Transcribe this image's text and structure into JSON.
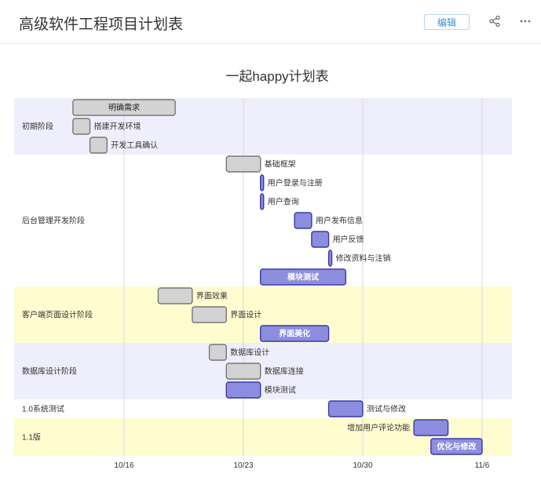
{
  "header": {
    "title": "高级软件工程项目计划表",
    "edit_label": "编辑",
    "share_icon": "share-icon",
    "more_icon": "more-icon"
  },
  "colors": {
    "band_a": "#efeefc",
    "band_b": "#fffdd0",
    "band_c": "#ffffff",
    "bar_done": "#d3d3d3",
    "bar_done_stroke": "#777777",
    "bar_active": "#8d8de0",
    "bar_active_stroke": "#3838a8",
    "grid": "#d8d8d8"
  },
  "chart_data": {
    "type": "gantt",
    "title": "一起happy计划表",
    "x_ticks": [
      "10/16",
      "10/23",
      "10/30",
      "11/6"
    ],
    "x_range": [
      "2023-10-10",
      "2023-11-08"
    ],
    "sections": [
      {
        "name": "初期阶段",
        "band": "a",
        "rows": 3
      },
      {
        "name": "后台管理开发阶段",
        "band": "c",
        "rows": 7
      },
      {
        "name": "客户端页面设计阶段",
        "band": "b",
        "rows": 3
      },
      {
        "name": "数据库设计阶段",
        "band": "a",
        "rows": 3
      },
      {
        "name": "1.0系统测试",
        "band": "c",
        "rows": 1
      },
      {
        "name": "1.1版",
        "band": "b",
        "rows": 2
      }
    ],
    "tasks": [
      {
        "name": "明确需求",
        "start": "2023-10-13",
        "end": "2023-10-19",
        "status": "done",
        "label": "inside"
      },
      {
        "name": "搭建开发环境",
        "start": "2023-10-13",
        "end": "2023-10-14",
        "status": "done",
        "label": "right"
      },
      {
        "name": "开发工具确认",
        "start": "2023-10-14",
        "end": "2023-10-15",
        "status": "done",
        "label": "right"
      },
      {
        "name": "基础框架",
        "start": "2023-10-22",
        "end": "2023-10-24",
        "status": "done",
        "label": "right"
      },
      {
        "name": "用户登录与注册",
        "start": "2023-10-24",
        "end": "2023-10-24",
        "status": "active",
        "label": "right"
      },
      {
        "name": "用户查询",
        "start": "2023-10-24",
        "end": "2023-10-24",
        "status": "active",
        "label": "right"
      },
      {
        "name": "用户发布信息",
        "start": "2023-10-26",
        "end": "2023-10-27",
        "status": "active",
        "label": "right"
      },
      {
        "name": "用户反馈",
        "start": "2023-10-27",
        "end": "2023-10-28",
        "status": "active",
        "label": "right"
      },
      {
        "name": "修改资料与注销",
        "start": "2023-10-28",
        "end": "2023-10-28",
        "status": "active",
        "label": "right"
      },
      {
        "name": "模块测试",
        "start": "2023-10-24",
        "end": "2023-10-29",
        "status": "active",
        "label": "inside"
      },
      {
        "name": "界面效果",
        "start": "2023-10-18",
        "end": "2023-10-20",
        "status": "done",
        "label": "right"
      },
      {
        "name": "界面设计",
        "start": "2023-10-20",
        "end": "2023-10-22",
        "status": "done",
        "label": "right"
      },
      {
        "name": "界面美化",
        "start": "2023-10-24",
        "end": "2023-10-28",
        "status": "active",
        "label": "inside"
      },
      {
        "name": "数据库设计",
        "start": "2023-10-21",
        "end": "2023-10-22",
        "status": "done",
        "label": "right"
      },
      {
        "name": "数据库连接",
        "start": "2023-10-22",
        "end": "2023-10-24",
        "status": "done",
        "label": "right"
      },
      {
        "name": "模块测试",
        "start": "2023-10-22",
        "end": "2023-10-24",
        "status": "active",
        "label": "right"
      },
      {
        "name": "测试与修改",
        "start": "2023-10-28",
        "end": "2023-10-30",
        "status": "active",
        "label": "right"
      },
      {
        "name": "增加用户评论功能",
        "start": "2023-11-02",
        "end": "2023-11-04",
        "status": "active",
        "label": "left"
      },
      {
        "name": "优化与修改",
        "start": "2023-11-03",
        "end": "2023-11-06",
        "status": "active",
        "label": "inside"
      }
    ]
  }
}
